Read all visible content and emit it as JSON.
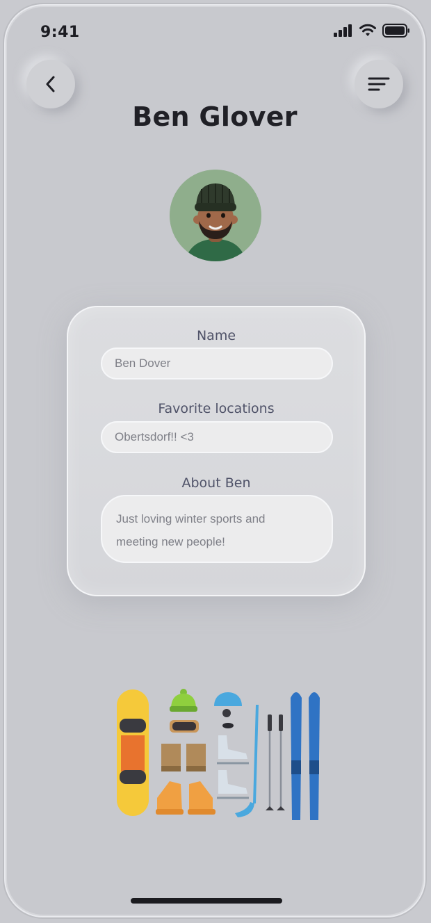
{
  "status_bar": {
    "time": "9:41"
  },
  "header": {
    "title": "Ben Glover"
  },
  "profile_form": {
    "name_label": "Name",
    "name_value": "Ben Dover",
    "locations_label": "Favorite locations",
    "locations_value": "Obertsdorf!! <3",
    "about_label": "About Ben",
    "about_line1": "Just loving winter sports and",
    "about_line2": "meeting new people!"
  },
  "icons": {
    "back": "chevron-left-icon",
    "menu": "sort-lines-icon",
    "signal": "signal-icon",
    "wifi": "wifi-icon",
    "battery": "battery-icon"
  },
  "colors": {
    "background": "#c8c9ce",
    "title": "#202026",
    "label": "#4f5268",
    "field_text": "#7f8088",
    "avatar_bg": "#8fae8c"
  }
}
